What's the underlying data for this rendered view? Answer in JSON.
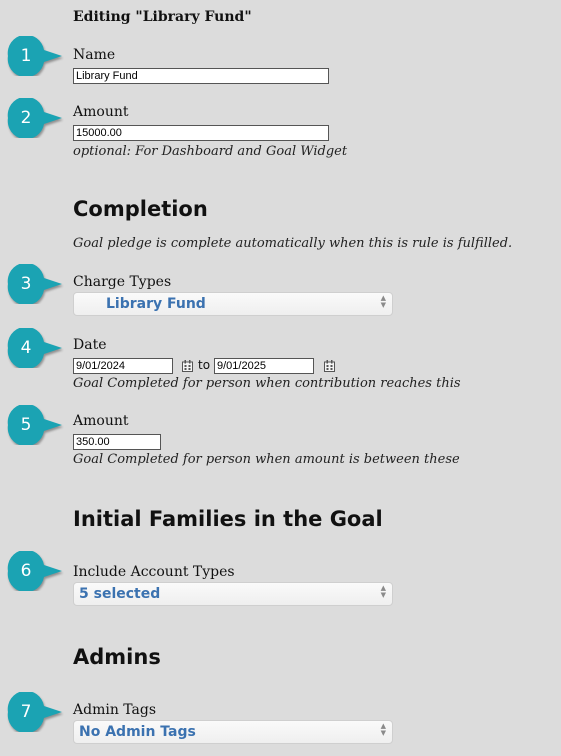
{
  "title": "Editing \"Library Fund\"",
  "markers": [
    "1",
    "2",
    "3",
    "4",
    "5",
    "6",
    "7"
  ],
  "name": {
    "label": "Name",
    "value": "Library Fund"
  },
  "amount": {
    "label": "Amount",
    "value": "15000.00",
    "hint": "optional: For Dashboard and Goal Widget"
  },
  "completion": {
    "heading": "Completion",
    "hint": "Goal pledge is complete automatically when this is rule is fulfilled.",
    "charge_types": {
      "label": "Charge Types",
      "value": "Library Fund"
    },
    "date": {
      "label": "Date",
      "from": "9/01/2024",
      "to_label": "to",
      "to": "9/01/2025",
      "hint": "Goal Completed for person when contribution reaches this"
    },
    "amount": {
      "label": "Amount",
      "value": "350.00",
      "hint": "Goal Completed for person when amount is between these"
    }
  },
  "initial_families": {
    "heading": "Initial Families in the Goal",
    "account_types": {
      "label": "Include Account Types",
      "value": "5 selected"
    }
  },
  "admins": {
    "heading": "Admins",
    "admin_tags": {
      "label": "Admin Tags",
      "value": "No Admin Tags"
    }
  },
  "colors": {
    "marker": "#1ba3b3",
    "select_text": "#3b72b0",
    "background": "#dcdcdc"
  },
  "icons": [
    "calendar-icon",
    "select-arrows-icon"
  ]
}
